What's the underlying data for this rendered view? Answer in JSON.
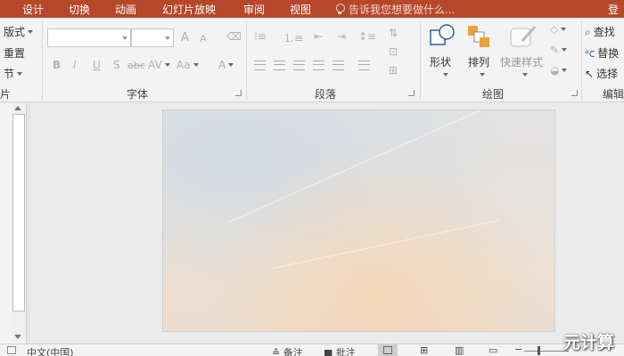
{
  "tabs": [
    "设计",
    "切换",
    "动画",
    "幻灯片放映",
    "审阅",
    "视图"
  ],
  "tell_me": "告诉我您想要做什么...",
  "login": "登录",
  "slides_group": {
    "layout": "版式",
    "reset": "重置",
    "section": "节",
    "label": "片"
  },
  "font_group": {
    "label": "字体",
    "bold": "B",
    "italic": "I",
    "underline": "U",
    "shadow": "S",
    "strike": "abc",
    "spacing": "AV",
    "case": "Aa",
    "color": "A",
    "grow": "A",
    "shrink": "A"
  },
  "paragraph_group": {
    "label": "段落"
  },
  "drawing_group": {
    "label": "绘图",
    "shapes": "形状",
    "arrange": "排列",
    "quick_styles": "快速样式"
  },
  "editing_group": {
    "label": "编辑",
    "find": "查找",
    "replace": "替换",
    "select": "选择"
  },
  "status": {
    "language": "中文(中国)",
    "notes": "备注",
    "comments": "批注"
  },
  "watermark": "元计算",
  "colors": {
    "accent": "#b7472a",
    "ribbon": "#f3f3f3",
    "canvas": "#ebebeb"
  }
}
